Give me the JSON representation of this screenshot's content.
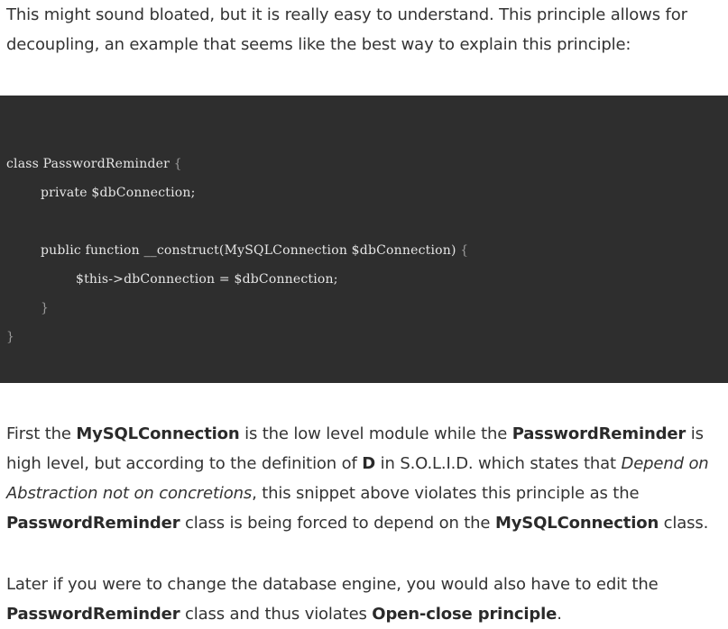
{
  "intro": {
    "text": "This might sound bloated, but it is really easy to understand. This principle allows for decoupling, an example that seems like the best way to explain this principle:"
  },
  "code": {
    "lines": [
      {
        "indent": 0,
        "text": "class PasswordReminder ",
        "brace": "{"
      },
      {
        "indent": 1,
        "text": "private $dbConnection;",
        "brace": ""
      },
      {
        "indent": 1,
        "text": "public function __construct(MySQLConnection $dbConnection) ",
        "brace": "{"
      },
      {
        "indent": 2,
        "text": "$this->dbConnection = $dbConnection;",
        "brace": ""
      },
      {
        "indent": 1,
        "text": "",
        "brace": "}"
      },
      {
        "indent": 0,
        "text": "",
        "brace": "}"
      }
    ]
  },
  "first_paragraph": {
    "t1": "First the ",
    "b1": "MySQLConnection",
    "t2": " is the low level module while the ",
    "b2": "PasswordReminder",
    "t3": " is high level, but according to the definition of ",
    "b3": "D",
    "t4": " in S.O.L.I.D. which states that ",
    "i1": "Depend on Abstraction not on concretions",
    "t5": ", this snippet above violates this principle as the ",
    "b4": "PasswordReminder",
    "t6": " class is being forced to depend on the ",
    "b5": "MySQLConnection",
    "t7": " class."
  },
  "later_paragraph": {
    "t1": "Later if you were to change the database engine, you would also have to edit the ",
    "b1": "PasswordReminder",
    "t2": " class and thus violates ",
    "b2": "Open-close principle",
    "t3": "."
  }
}
